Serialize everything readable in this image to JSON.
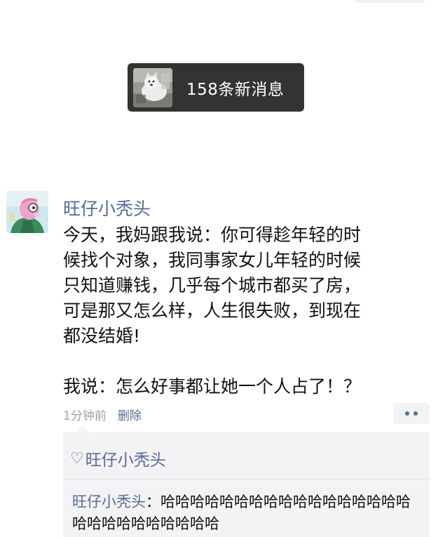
{
  "notification": {
    "text": "158条新消息",
    "avatar_icon": "dog-photo-icon"
  },
  "post": {
    "author": "旺仔小秃头",
    "avatar_icon": "cartoon-avatar-icon",
    "body_lines": [
      "今天，我妈跟我说：你可得趁年轻的时",
      "候找个对象，我同事家女儿年轻的时候",
      "只知道赚钱，几乎每个城市都买了房，",
      "可是那又怎么样，人生很失败，到现在",
      "都没结婚!"
    ],
    "second_paragraph": "我说：怎么好事都让她一个人占了！？",
    "time": "1分钟前",
    "delete_label": "删除",
    "more_icon": "more-dots-icon"
  },
  "likes": {
    "icon": "heart-icon",
    "icon_glyph": "♡",
    "names": "旺仔小秃头"
  },
  "comment": {
    "author": "旺仔小秃头",
    "separator": "：",
    "text": "哈哈哈哈哈哈哈哈哈哈哈哈哈哈哈哈哈哈哈哈哈哈哈哈哈哈哈"
  },
  "colors": {
    "link": "#576b95",
    "notify_bg": "#333333",
    "comment_bg": "#f3f3f5",
    "meta_gray": "#a0a0a0"
  }
}
